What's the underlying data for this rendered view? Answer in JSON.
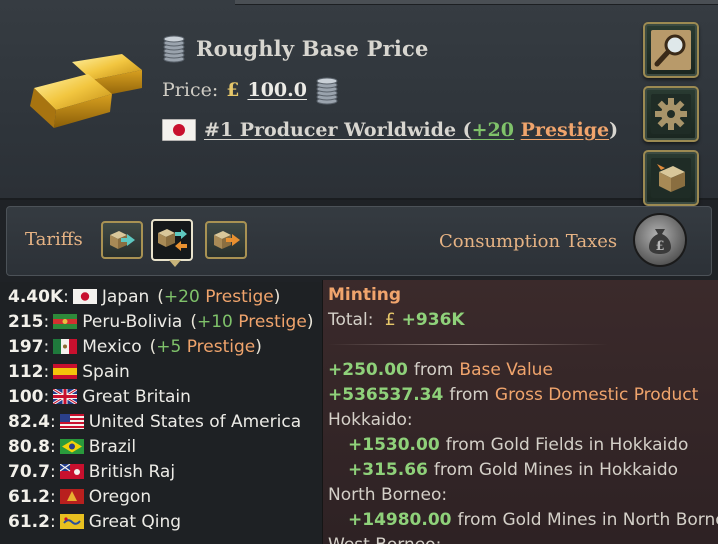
{
  "header": {
    "title": "Roughly Base Price",
    "price_label": "Price:",
    "currency_symbol": "£",
    "price_value": "100.0",
    "producer_rank": "#1 Producer Worldwide (",
    "producer_prestige": "+20",
    "producer_prestige_word": "Prestige",
    "producer_close": ")"
  },
  "side_buttons": [
    {
      "icon": "magnifier-icon"
    },
    {
      "icon": "gear-icon"
    },
    {
      "icon": "crate-icon"
    }
  ],
  "tariffs": {
    "label": "Tariffs",
    "consumption_label": "Consumption Taxes"
  },
  "producers": [
    {
      "value": "4.40K",
      "country": "Japan",
      "prestige_amt": "+20",
      "prestige_word": "Prestige",
      "flag": "japan"
    },
    {
      "value": "215",
      "country": "Peru-Bolivia",
      "prestige_amt": "+10",
      "prestige_word": "Prestige",
      "flag": "peru"
    },
    {
      "value": "197",
      "country": "Mexico",
      "prestige_amt": "+5",
      "prestige_word": "Prestige",
      "flag": "mexico"
    },
    {
      "value": "112",
      "country": "Spain",
      "flag": "spain"
    },
    {
      "value": "100",
      "country": "Great Britain",
      "flag": "uk"
    },
    {
      "value": "82.4",
      "country": "United States of America",
      "flag": "usa"
    },
    {
      "value": "80.8",
      "country": "Brazil",
      "flag": "brazil"
    },
    {
      "value": "70.7",
      "country": "British Raj",
      "flag": "raj"
    },
    {
      "value": "61.2",
      "country": "Oregon",
      "flag": "oregon"
    },
    {
      "value": "61.2",
      "country": "Great Qing",
      "flag": "qing"
    }
  ],
  "tooltip": {
    "title": "Minting",
    "total_label": "Total:",
    "total_currency": "£",
    "total_value": "+936K",
    "lines": {
      "base_amt": "+250.00",
      "base_from": "from",
      "base_src": "Base Value",
      "gdp_amt": "+536537.34",
      "gdp_from": "from",
      "gdp_src": "Gross Domestic Product",
      "state1": "Hokkaido:",
      "s1a_amt": "+1530.00",
      "s1a_text": "from Gold Fields in Hokkaido",
      "s1b_amt": "+315.66",
      "s1b_text": "from Gold Mines in Hokkaido",
      "state2": "North Borneo:",
      "s2a_amt": "+14980.00",
      "s2a_text": "from Gold Mines in North Borneo",
      "state3": "West Borneo:"
    }
  },
  "colors": {
    "accent_orange": "#f0a46c",
    "positive_green": "#8fd17a",
    "gold": "#e6c76a"
  }
}
